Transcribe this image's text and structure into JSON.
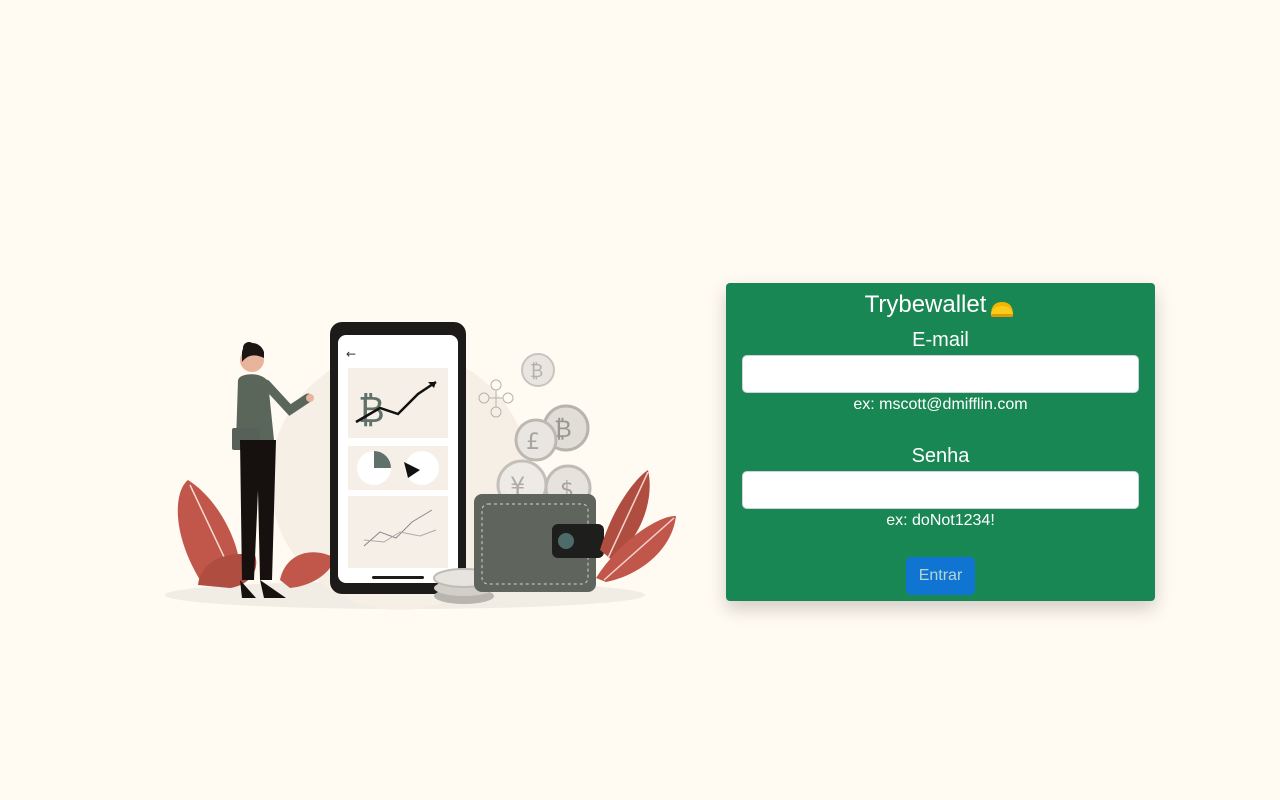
{
  "app": {
    "title": "Trybewallet",
    "title_icon": "wallet-emoji-icon"
  },
  "form": {
    "email": {
      "label": "E-mail",
      "value": "",
      "hint": "ex: mscott@dmifflin.com"
    },
    "password": {
      "label": "Senha",
      "value": "",
      "hint": "ex: doNot1234!"
    },
    "submit_label": "Entrar"
  },
  "colors": {
    "background": "#fffaf2",
    "card": "#198754",
    "button": "#0d6efd"
  },
  "illustration": {
    "subject": "woman-with-phone-crypto-wallet-illustration"
  }
}
